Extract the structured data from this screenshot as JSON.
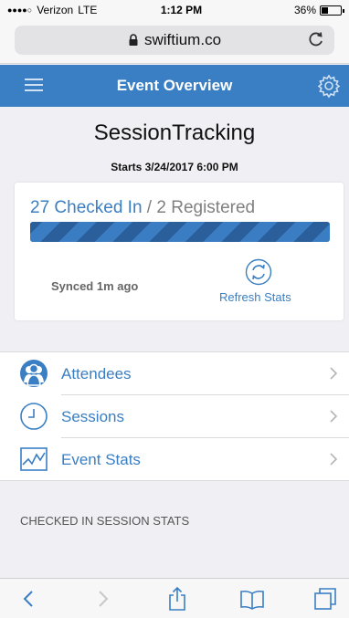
{
  "status_bar": {
    "carrier": "Verizon",
    "network": "LTE",
    "time": "1:12 PM",
    "battery": "36%",
    "battery_level": 0.36
  },
  "browser": {
    "url": "swiftium.co",
    "icons": {
      "lock": "lock-icon",
      "reload": "reload-icon"
    }
  },
  "header": {
    "title": "Event Overview",
    "icons": {
      "menu": "hamburger-menu-icon",
      "settings": "gear-icon"
    }
  },
  "event": {
    "name": "SessionTracking",
    "start": "Starts 3/24/2017 6:00 PM"
  },
  "stats": {
    "checked_in_text": "27 Checked In",
    "separator": " / ",
    "registered_text": "2 Registered",
    "progress": 1.0,
    "synced": "Synced 1m ago",
    "refresh_label": "Refresh Stats"
  },
  "nav": {
    "items": [
      {
        "label": "Attendees",
        "icon": "attendees-icon"
      },
      {
        "label": "Sessions",
        "icon": "clock-icon"
      },
      {
        "label": "Event Stats",
        "icon": "chart-icon"
      }
    ]
  },
  "section": {
    "title": "CHECKED IN SESSION STATS"
  },
  "toolbar": {
    "icons": [
      "back-icon",
      "forward-icon",
      "share-icon",
      "bookmarks-icon",
      "tabs-icon"
    ]
  },
  "colors": {
    "accent": "#3a7ec3",
    "background": "#efeff4"
  }
}
